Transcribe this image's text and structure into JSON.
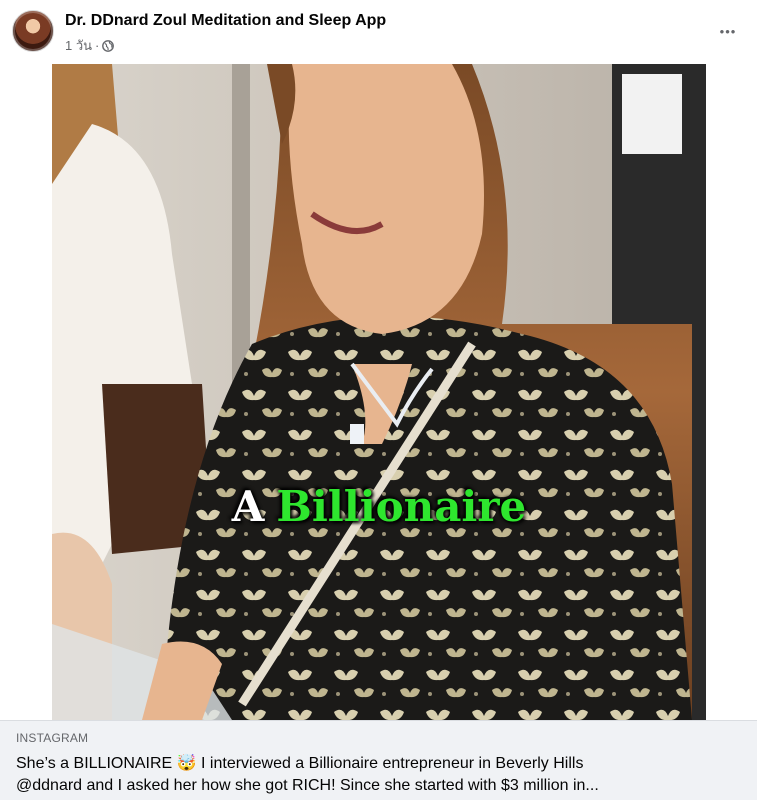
{
  "post": {
    "page_name": "Dr. DDnard Zoul Meditation and Sleep App",
    "time_ago": "1 วัน",
    "separator": "·",
    "privacy_icon": "globe-icon",
    "more_icon": "more-horizontal-icon",
    "more_label": "•••"
  },
  "video": {
    "overlay_word1": "A",
    "overlay_word2": "Billionaire"
  },
  "link_preview": {
    "source": "INSTAGRAM",
    "line1": "She’s a BILLIONAIRE 🤯 I interviewed a Billionaire entrepreneur in Beverly Hills",
    "line2": "@ddnard and I asked her how she got RICH! Since she started with $3 million in..."
  },
  "colors": {
    "caption_green": "#2ee62e",
    "text_primary": "#050505",
    "text_secondary": "#65676b",
    "preview_bg": "#f0f2f5"
  }
}
